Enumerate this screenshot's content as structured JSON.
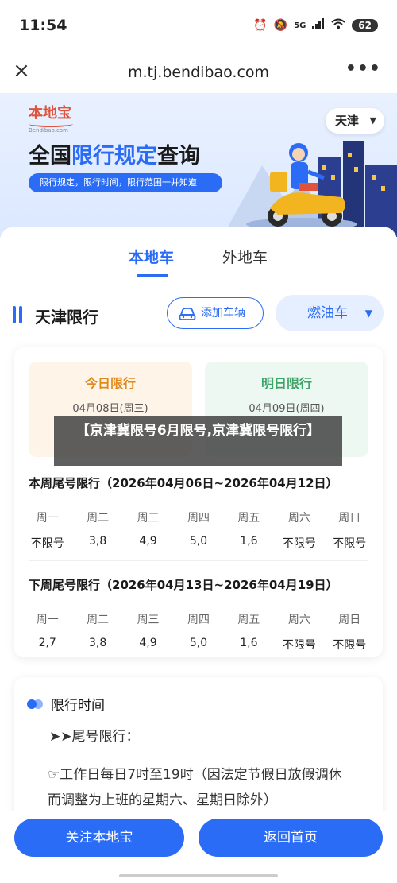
{
  "status": {
    "time": "11:54",
    "signal": "5G",
    "battery": "62"
  },
  "browser": {
    "close": "×",
    "url": "m.tj.bendibao.com",
    "more": "•••"
  },
  "banner": {
    "logo": "本地宝",
    "logo_sub": "Bendibao.com",
    "title_pre": "全国",
    "title_hl": "限行规定",
    "title_post": "查询",
    "pill": "限行规定，限行时间，限行范围一并知道",
    "city": "天津"
  },
  "tabs": {
    "local": "本地车",
    "out": "外地车"
  },
  "section": {
    "title": "天津限行",
    "add_car": "添加车辆",
    "fuel": "燃油车"
  },
  "today": {
    "title": "今日限行",
    "date": "04月08日(周三)"
  },
  "tomorrow": {
    "title": "明日限行",
    "date": "04月09日(周四)"
  },
  "caption": "【京津冀限号6月限号,京津冀限号限行】",
  "this_week": {
    "title": "本周尾号限行（2026年04月06日~2026年04月12日）",
    "days": [
      "周一",
      "周二",
      "周三",
      "周四",
      "周五",
      "周六",
      "周日"
    ],
    "values": [
      "不限号",
      "3,8",
      "4,9",
      "5,0",
      "1,6",
      "不限号",
      "不限号"
    ]
  },
  "next_week": {
    "title": "下周尾号限行（2026年04月13日~2026年04月19日）",
    "days": [
      "周一",
      "周二",
      "周三",
      "周四",
      "周五",
      "周六",
      "周日"
    ],
    "values": [
      "2,7",
      "3,8",
      "4,9",
      "5,0",
      "1,6",
      "不限号",
      "不限号"
    ]
  },
  "time_card": {
    "title": "限行时间",
    "line1": "➤➤尾号限行：",
    "line2": "☞工作日每日7时至19时（因法定节假日放假调休",
    "line3": "而调整为上班的星期六、星期日除外）"
  },
  "buttons": {
    "follow": "关注本地宝",
    "home": "返回首页"
  }
}
